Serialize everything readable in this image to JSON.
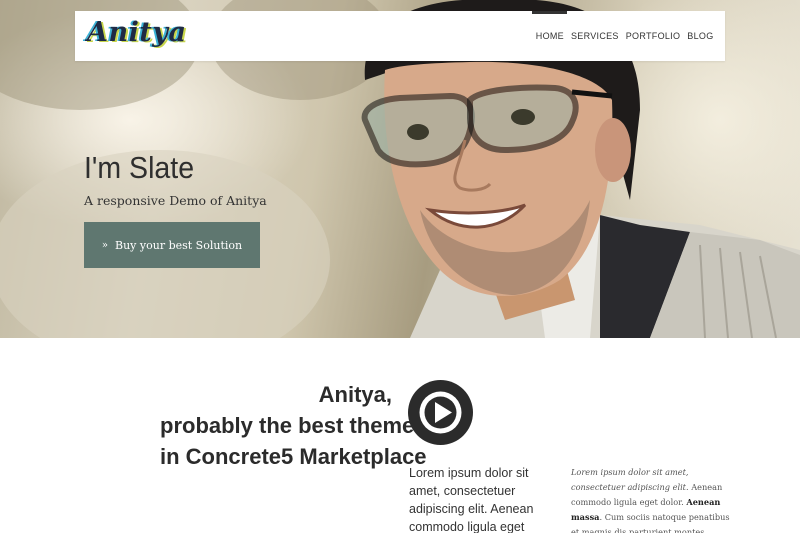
{
  "header": {
    "logo_text": "Anitya",
    "nav_items": [
      {
        "label": "HOME",
        "active": true
      },
      {
        "label": "SERVICES",
        "active": false
      },
      {
        "label": "PORTFOLIO",
        "active": false
      },
      {
        "label": "BLOG",
        "active": false
      }
    ]
  },
  "hero": {
    "title": "I'm Slate",
    "subtitle": "A responsive Demo of Anitya",
    "cta_label": "Buy your best Solution",
    "cta_icon": "double-chevron-right-icon",
    "cta_color": "#5f7770"
  },
  "content": {
    "headline_lines": [
      "Anitya,",
      "probably the best theme",
      "in Concrete5 Marketplace"
    ],
    "play_icon": "play-circle-icon",
    "lorem_large": "Lorem ipsum dolor sit amet, consectetuer adipiscing elit. Aenean commodo ligula eget",
    "lorem_small": {
      "italic": "Lorem ipsum dolor sit amet, consectetuer adipiscing elit.",
      "plain_1": " Aenean commodo ligula eget dolor. ",
      "bold": "Aenean massa",
      "plain_2": ". Cum sociis natoque penatibus et magnis dis parturient montes,"
    }
  }
}
